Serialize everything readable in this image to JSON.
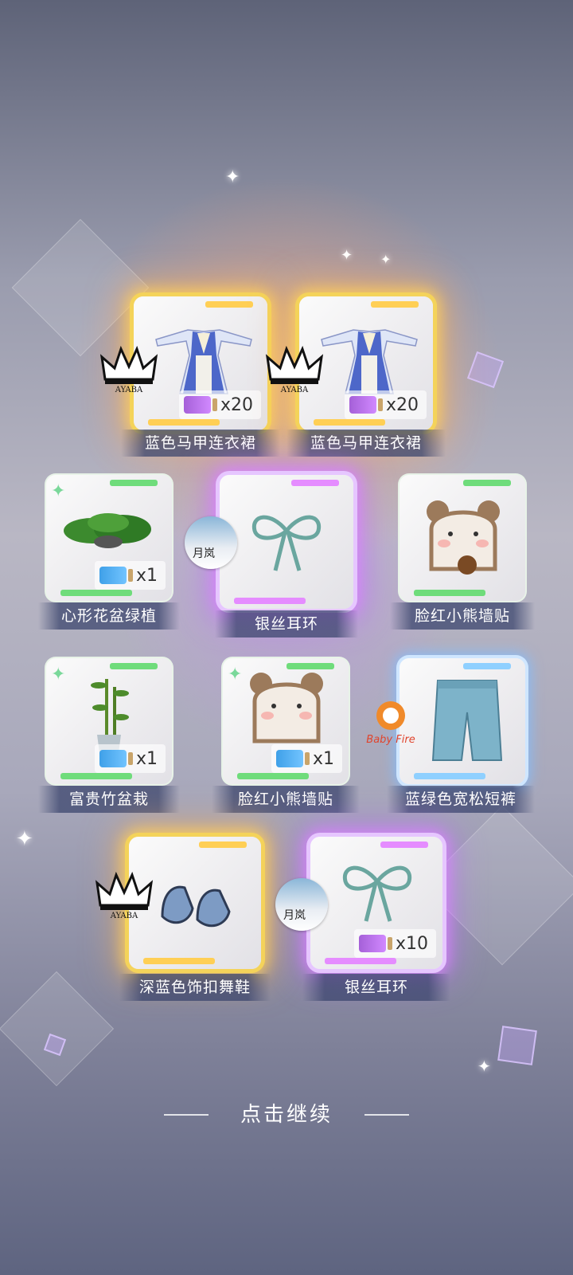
{
  "rewards": [
    {
      "name": "蓝色马甲连衣裙",
      "quantity": "x20",
      "rarity": "gold",
      "brand": "crown",
      "item": "blue-vest-dress"
    },
    {
      "name": "蓝色马甲连衣裙",
      "quantity": "x20",
      "rarity": "gold",
      "brand": "crown",
      "item": "blue-vest-dress"
    },
    {
      "name": "心形花盆绿植",
      "quantity": "x1",
      "rarity": "green",
      "item": "potted-plant"
    },
    {
      "name": "银丝耳环",
      "quantity": "",
      "rarity": "purple",
      "brand": "moon",
      "item": "ribbon-earring"
    },
    {
      "name": "脸红小熊墙贴",
      "quantity": "",
      "rarity": "green",
      "item": "bear-sticker"
    },
    {
      "name": "富贵竹盆栽",
      "quantity": "x1",
      "rarity": "green",
      "item": "bamboo-pot"
    },
    {
      "name": "脸红小熊墙贴",
      "quantity": "x1",
      "rarity": "green",
      "item": "bear-sticker"
    },
    {
      "name": "蓝绿色宽松短裤",
      "quantity": "",
      "rarity": "blue",
      "brand": "babyfire",
      "item": "loose-shorts"
    },
    {
      "name": "深蓝色饰扣舞鞋",
      "quantity": "",
      "rarity": "gold",
      "brand": "crown",
      "item": "dance-shoes"
    },
    {
      "name": "银丝耳环",
      "quantity": "x10",
      "rarity": "purple",
      "brand": "moon",
      "item": "ribbon-earring"
    }
  ],
  "brands": {
    "crown_text": "AYABA",
    "moon_text": "月岚",
    "babyfire_text": "Baby Fire"
  },
  "continue_label": "点击继续",
  "colors": {
    "gold": "#f4d35a",
    "purple": "#e58cff",
    "green": "#6fdc7b",
    "blue": "#8fd0ff"
  }
}
